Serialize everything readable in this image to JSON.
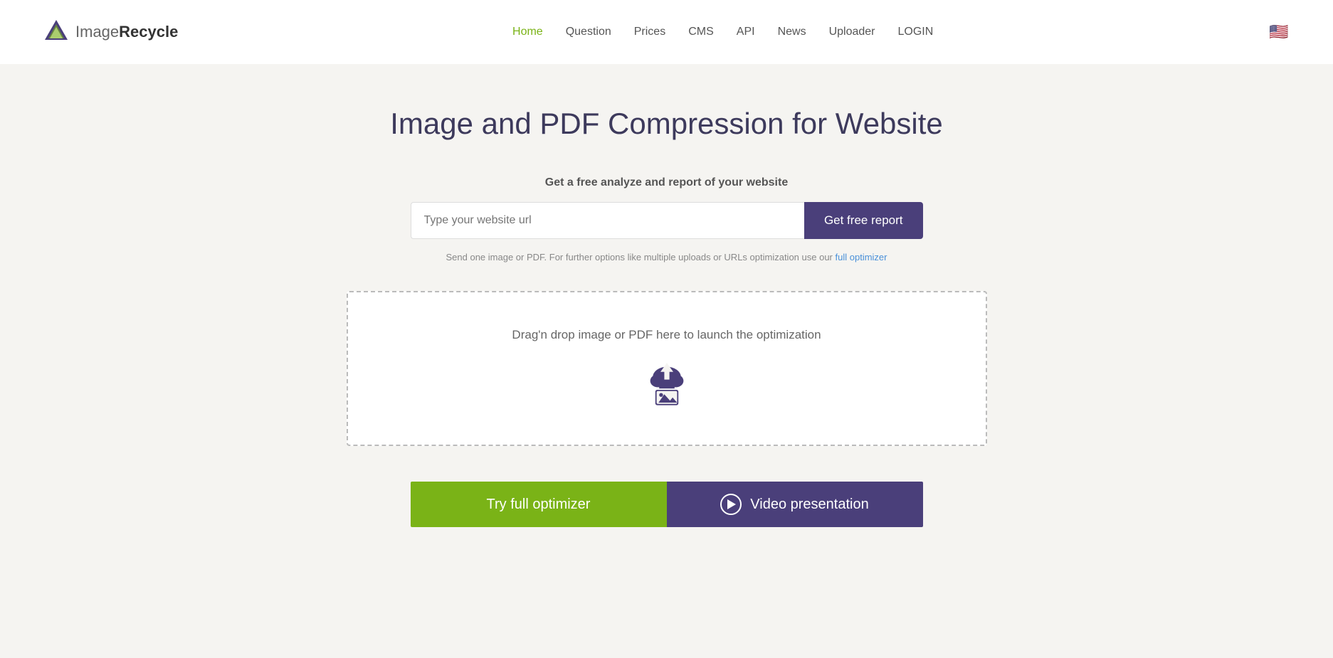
{
  "logo": {
    "text_image": "Image",
    "text_recycle": "Recycle"
  },
  "nav": {
    "items": [
      {
        "label": "Home",
        "active": true
      },
      {
        "label": "Question",
        "active": false
      },
      {
        "label": "Prices",
        "active": false
      },
      {
        "label": "CMS",
        "active": false
      },
      {
        "label": "API",
        "active": false
      },
      {
        "label": "News",
        "active": false
      },
      {
        "label": "Uploader",
        "active": false
      },
      {
        "label": "LOGIN",
        "active": false
      }
    ]
  },
  "hero": {
    "title": "Image and PDF Compression for Website",
    "subtitle": "Get a free analyze and report of your website",
    "url_placeholder": "Type your website url",
    "get_report_label": "Get free report",
    "helper_text": "Send one image or PDF. For further options like multiple uploads or URLs optimization use our",
    "helper_link_text": "full optimizer",
    "drop_text": "Drag'n drop image or PDF here to launch the optimization",
    "cta_optimizer_label": "Try full optimizer",
    "cta_video_label": "Video presentation"
  }
}
